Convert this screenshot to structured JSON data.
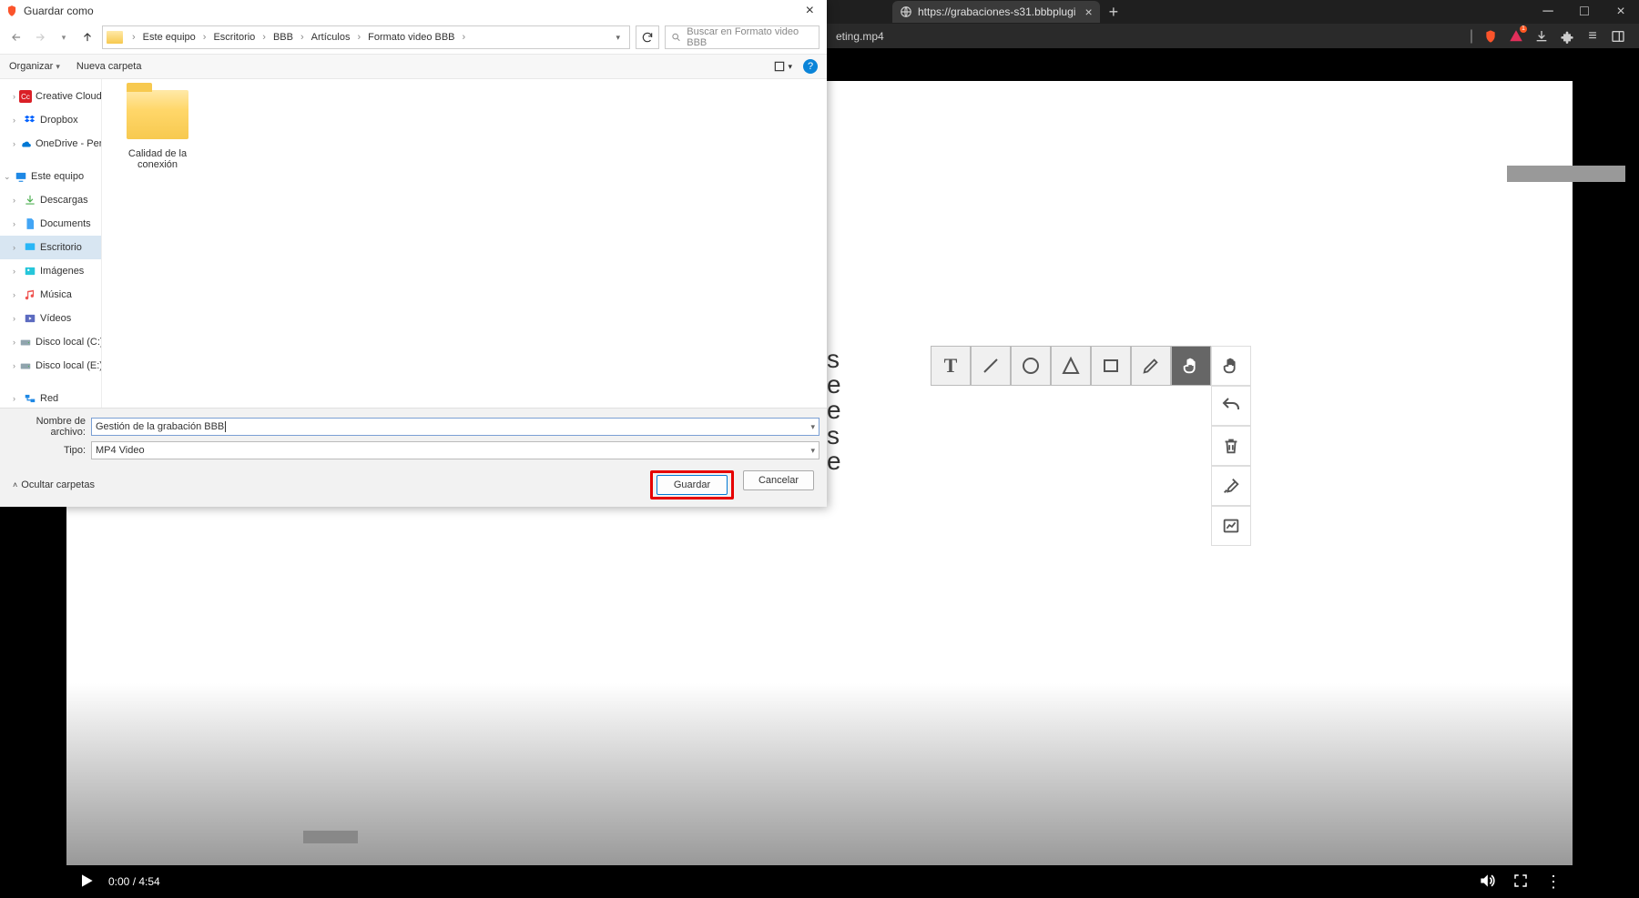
{
  "browser": {
    "tab_title": "https://grabaciones-s31.bbbplugi",
    "address_fragment": "eting.mp4"
  },
  "dialog": {
    "title": "Guardar como",
    "breadcrumb": [
      "Este equipo",
      "Escritorio",
      "BBB",
      "Artículos",
      "Formato video BBB"
    ],
    "search_placeholder": "Buscar en Formato video BBB",
    "toolbar": {
      "organize": "Organizar",
      "new_folder": "Nueva carpeta"
    },
    "sidebar": [
      {
        "label": "Creative Cloud F",
        "icon": "cc",
        "chevron": ">",
        "indent": 1
      },
      {
        "label": "Dropbox",
        "icon": "dropbox",
        "chevron": ">",
        "indent": 1
      },
      {
        "label": "OneDrive - Perso",
        "icon": "onedrive",
        "chevron": ">",
        "indent": 1
      },
      {
        "spacer": true
      },
      {
        "label": "Este equipo",
        "icon": "pc",
        "chevron": "v",
        "indent": 0
      },
      {
        "label": "Descargas",
        "icon": "download",
        "chevron": ">",
        "indent": 1
      },
      {
        "label": "Documents",
        "icon": "docs",
        "chevron": ">",
        "indent": 1
      },
      {
        "label": "Escritorio",
        "icon": "desktop",
        "chevron": ">",
        "indent": 1,
        "selected": true
      },
      {
        "label": "Imágenes",
        "icon": "images",
        "chevron": ">",
        "indent": 1
      },
      {
        "label": "Música",
        "icon": "music",
        "chevron": ">",
        "indent": 1
      },
      {
        "label": "Vídeos",
        "icon": "videos",
        "chevron": ">",
        "indent": 1
      },
      {
        "label": "Disco local (C:)",
        "icon": "disk",
        "chevron": ">",
        "indent": 1
      },
      {
        "label": "Disco local (E:)",
        "icon": "disk",
        "chevron": ">",
        "indent": 1
      },
      {
        "spacer": true
      },
      {
        "label": "Red",
        "icon": "network",
        "chevron": ">",
        "indent": 1
      }
    ],
    "content_folder": "Calidad de la conexión",
    "filename_label": "Nombre de archivo:",
    "filename_value": "Gestión de la grabación BBB",
    "type_label": "Tipo:",
    "type_value": "MP4 Video",
    "hide_folders": "Ocultar carpetas",
    "save_button": "Guardar",
    "cancel_button": "Cancelar"
  },
  "video": {
    "time": "0:00 / 4:54",
    "obscured_letters": "s\ne\ne\ns\ne"
  },
  "tools": [
    "text",
    "line",
    "circle",
    "triangle",
    "rect",
    "pencil",
    "hand",
    "pointer"
  ],
  "side_tools": [
    "undo",
    "trash",
    "paint",
    "chart"
  ]
}
